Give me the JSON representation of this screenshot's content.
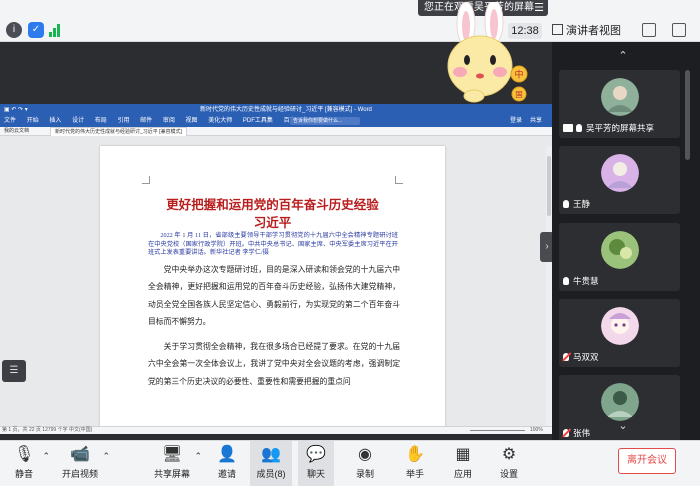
{
  "banner": {
    "sharing_text": "您正在观看吴平芳的屏幕",
    "menu": "☰"
  },
  "topbar": {
    "time": "12:38",
    "view_label": "演讲者视图"
  },
  "word": {
    "title": "新时代党的伟大历史性成就与经验研讨_习近平 [兼容模式] - Word",
    "ribbon_tabs": [
      "文件",
      "开始",
      "插入",
      "设计",
      "布局",
      "引用",
      "邮件",
      "审阅",
      "视图",
      "美化大师",
      "PDF工具集",
      "百度网盘"
    ],
    "search": "告诉我你想要做什么...",
    "login": "登录",
    "share": "共享",
    "home_tab": "我的云文档",
    "doc_tab": "新时代党的伟大历史性成就与经验研讨_习近平 [兼容模式]",
    "status": "第 1 页，共 22 页    12799 个字    中文(中国)",
    "zoom": "100%"
  },
  "document": {
    "title": "更好把握和运用党的百年奋斗历史经验",
    "author": "习近平",
    "lead": "2022 年 1 月 11 日，省部级主要领导干部学习贯彻党的十九届六中全会精神专题研讨班在中央党校（国家行政学院）开班。中共中央总书记、国家主席、中央军委主席习近平在开班式上发表重要讲话。新华社记者 李学仁/摄",
    "para1": "党中央举办这次专题研讨班，目的是深入研读和领会党的十九届六中全会精神，更好把握和运用党的百年奋斗历史经验，弘扬伟大建党精神，动员全党全国各族人民坚定信心、勇毅前行，为实现党的第二个百年奋斗目标而不懈努力。",
    "para2": "关于学习贯彻全会精神，我在很多场合已经提了要求。在党的十九届六中全会第一次全体会议上，我讲了党中央对全会议题的考虑，强调制定党的第三个历史决议的必要性、重要性和需要把握的重点问"
  },
  "bunny": {
    "badge_top": "中",
    "badge_bottom": "国"
  },
  "participants": [
    {
      "name": "吴平芳的屏幕共享",
      "mic": "on",
      "sharing": true
    },
    {
      "name": "王静",
      "mic": "on"
    },
    {
      "name": "牛贵慧",
      "mic": "on"
    },
    {
      "name": "马双双",
      "mic": "off"
    },
    {
      "name": "张伟",
      "mic": "off"
    }
  ],
  "toolbar": {
    "mute": "静音",
    "video": "开启视频",
    "share": "共享屏幕",
    "invite": "邀请",
    "members": "成员(8)",
    "chat": "聊天",
    "record": "录制",
    "raise_hand": "举手",
    "apps": "应用",
    "settings": "设置",
    "leave": "离开会议"
  }
}
